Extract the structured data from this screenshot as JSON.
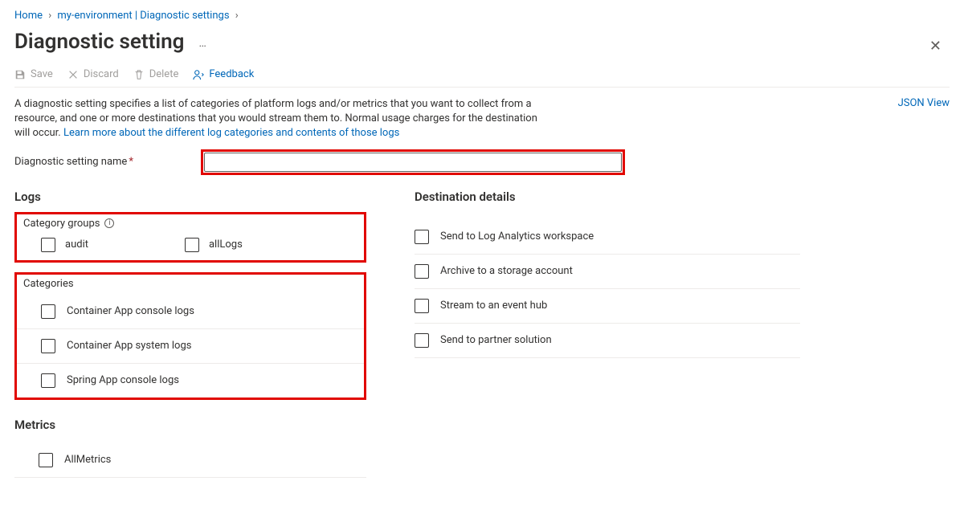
{
  "breadcrumb": {
    "home": "Home",
    "env": "my-environment | Diagnostic settings"
  },
  "heading": "Diagnostic setting",
  "toolbar": {
    "save": "Save",
    "discard": "Discard",
    "delete": "Delete",
    "feedback": "Feedback"
  },
  "description": {
    "text": "A diagnostic setting specifies a list of categories of platform logs and/or metrics that you want to collect from a resource, and one or more destinations that you would stream them to. Normal usage charges for the destination will occur. ",
    "link": "Learn more about the different log categories and contents of those logs"
  },
  "json_view": "JSON View",
  "name_field": {
    "label": "Diagnostic setting name",
    "value": ""
  },
  "logs": {
    "heading": "Logs",
    "category_groups": {
      "title": "Category groups",
      "items": [
        {
          "key": "audit",
          "label": "audit"
        },
        {
          "key": "allLogs",
          "label": "allLogs"
        }
      ]
    },
    "categories": {
      "title": "Categories",
      "items": [
        {
          "key": "container_console",
          "label": "Container App console logs"
        },
        {
          "key": "container_system",
          "label": "Container App system logs"
        },
        {
          "key": "spring_console",
          "label": "Spring App console logs"
        }
      ]
    }
  },
  "metrics": {
    "heading": "Metrics",
    "items": [
      {
        "key": "all_metrics",
        "label": "AllMetrics"
      }
    ]
  },
  "destinations": {
    "heading": "Destination details",
    "items": [
      {
        "key": "log_analytics",
        "label": "Send to Log Analytics workspace"
      },
      {
        "key": "storage",
        "label": "Archive to a storage account"
      },
      {
        "key": "eventhub",
        "label": "Stream to an event hub"
      },
      {
        "key": "partner",
        "label": "Send to partner solution"
      }
    ]
  }
}
